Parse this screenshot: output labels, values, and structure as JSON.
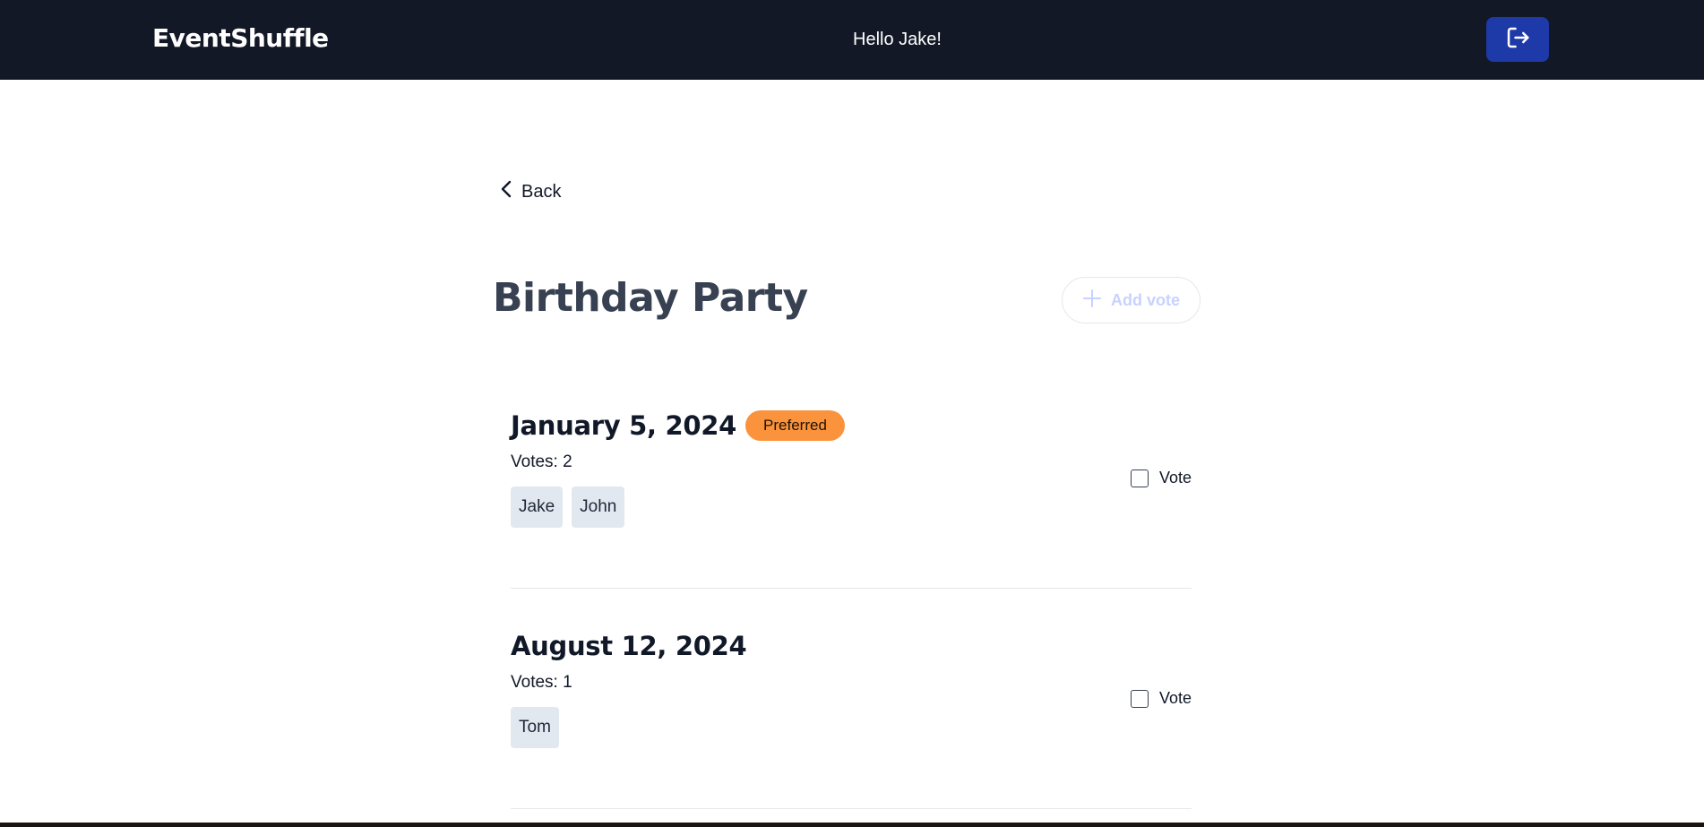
{
  "header": {
    "brand": "EventShuffle",
    "greeting": "Hello Jake!",
    "logout_icon": "logout-icon"
  },
  "nav": {
    "back_label": "Back",
    "back_icon": "chevron-left-icon"
  },
  "event": {
    "title": "Birthday Party",
    "add_vote_label": "Add vote",
    "add_vote_icon": "plus-icon"
  },
  "dates": [
    {
      "date": "January 5, 2024",
      "badge": "Preferred",
      "votes_label": "Votes: 2",
      "voters": [
        "Jake",
        "John"
      ],
      "vote_label": "Vote",
      "checked": false
    },
    {
      "date": "August 12, 2024",
      "badge": "",
      "votes_label": "Votes: 1",
      "voters": [
        "Tom"
      ],
      "vote_label": "Vote",
      "checked": false
    }
  ],
  "colors": {
    "header_bg": "#121826",
    "logout_bg": "#1e3aa8",
    "badge_bg": "#fb923c",
    "chip_bg": "#e2e8f0",
    "title_color": "#374151",
    "add_vote_color": "#c7d2fe"
  }
}
